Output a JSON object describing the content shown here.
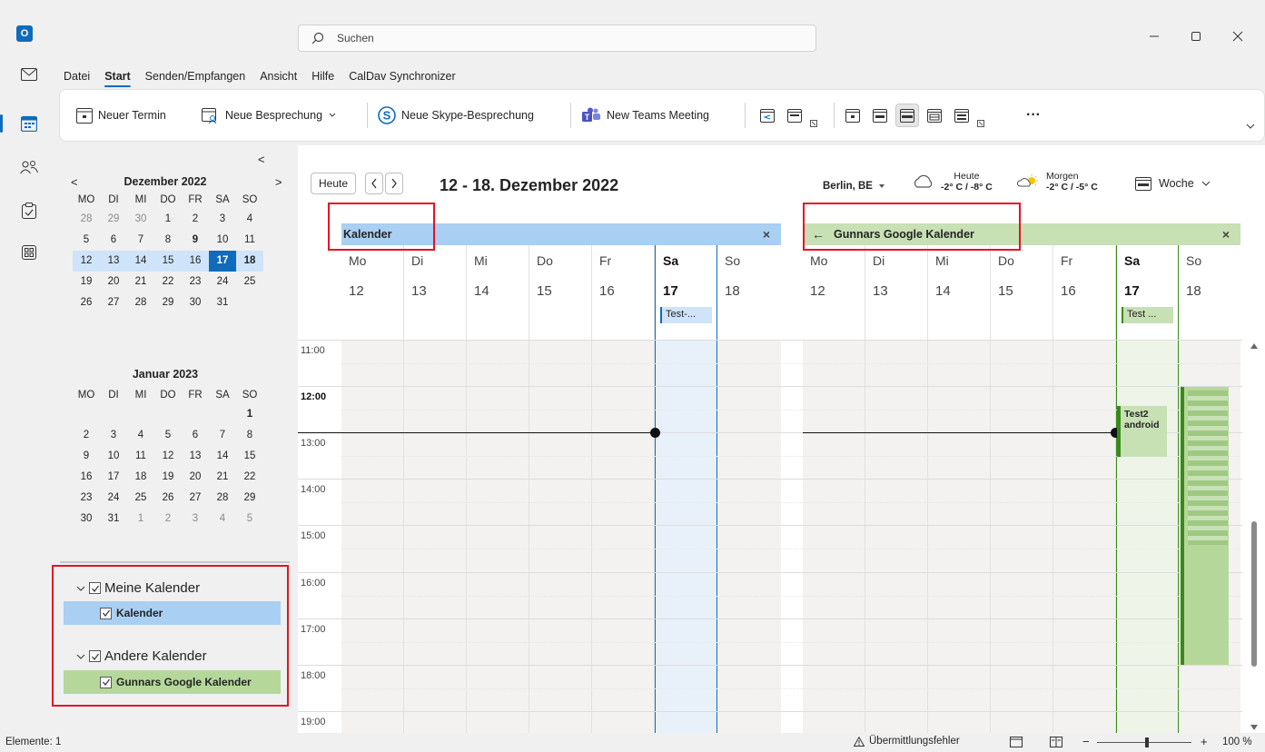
{
  "window": {
    "search_placeholder": "Suchen",
    "app_icon_letter": "O"
  },
  "menu": {
    "items": [
      "Datei",
      "Start",
      "Senden/Empfangen",
      "Ansicht",
      "Hilfe",
      "CalDav Synchronizer"
    ],
    "active": "Start"
  },
  "ribbon": {
    "new_appointment": "Neuer Termin",
    "new_meeting": "Neue Besprechung",
    "new_skype": "Neue Skype-Besprechung",
    "new_teams": "New Teams Meeting",
    "more": "···"
  },
  "left_pane": {
    "collapse": "<",
    "dec": {
      "title": "Dezember 2022",
      "prev": "<",
      "next": ">",
      "weekdays": [
        "MO",
        "DI",
        "MI",
        "DO",
        "FR",
        "SA",
        "SO"
      ],
      "days": [
        "28",
        "29",
        "30",
        "1",
        "2",
        "3",
        "4",
        "5",
        "6",
        "7",
        "8",
        "9",
        "10",
        "11",
        "12",
        "13",
        "14",
        "15",
        "16",
        "17",
        "18",
        "19",
        "20",
        "21",
        "22",
        "23",
        "24",
        "25",
        "26",
        "27",
        "28",
        "29",
        "30",
        "31"
      ]
    },
    "jan": {
      "title": "Januar 2023",
      "weekdays": [
        "MO",
        "DI",
        "MI",
        "DO",
        "FR",
        "SA",
        "SO"
      ],
      "days": [
        "1",
        "2",
        "3",
        "4",
        "5",
        "6",
        "7",
        "8",
        "9",
        "10",
        "11",
        "12",
        "13",
        "14",
        "15",
        "16",
        "17",
        "18",
        "19",
        "20",
        "21",
        "22",
        "23",
        "24",
        "25",
        "26",
        "27",
        "28",
        "29",
        "30",
        "31",
        "1",
        "2",
        "3",
        "4",
        "5"
      ]
    },
    "groups": {
      "mine": "Meine Kalender",
      "mine_item": "Kalender",
      "other": "Andere Kalender",
      "other_item": "Gunnars Google Kalender"
    },
    "colors": {
      "blue_cal": "#a9cff2",
      "green_cal": "#b5d89a"
    }
  },
  "toolbar": {
    "today": "Heute",
    "prev": "<",
    "next": ">",
    "range": "12 - 18. Dezember 2022",
    "location": "Berlin, BE",
    "weather_today_label": "Heute",
    "weather_today_temp": "-2° C / -8° C",
    "weather_tomorrow_label": "Morgen",
    "weather_tomorrow_temp": "-2° C / -5° C",
    "view": "Woche"
  },
  "panes": {
    "left_title": "Kalender",
    "right_title": "Gunnars Google Kalender",
    "close": "×",
    "back": "←",
    "day_names": [
      "Mo",
      "Di",
      "Mi",
      "Do",
      "Fr",
      "Sa",
      "So"
    ],
    "day_dates": [
      "12",
      "13",
      "14",
      "15",
      "16",
      "17",
      "18"
    ],
    "left_event": "Test-...",
    "right_event": "Test ...",
    "right_event2": "Test2 android",
    "times": [
      "11:00",
      "12:00",
      "13:00",
      "14:00",
      "15:00",
      "16:00",
      "17:00",
      "18:00",
      "19:00"
    ],
    "bold_time": "12:00"
  },
  "status": {
    "items": "Elemente: 1",
    "error": "Übermittlungsfehler",
    "zoom": "100 %",
    "minus": "−",
    "plus": "+"
  }
}
